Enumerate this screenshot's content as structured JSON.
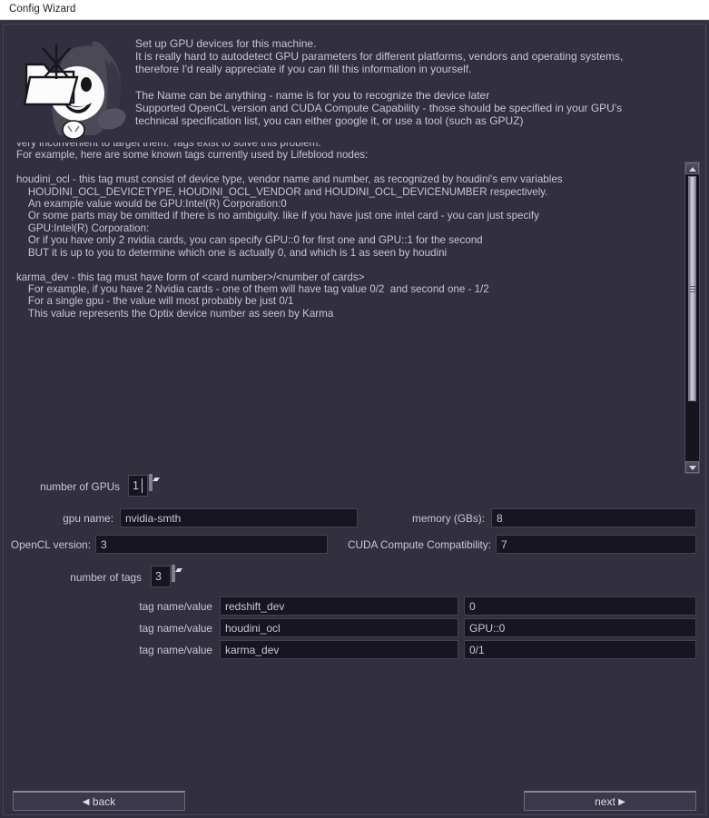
{
  "window": {
    "title": "Config Wizard"
  },
  "header": {
    "intro_text": "Set up GPU devices for this machine.\nIt is really hard to autodetect GPU parameters for different platforms, vendors and operating systems,\ntherefore I'd really appreciate if you can fill this information in yourself.\n\nThe Name can be anything - name is for you to recognize the device later\nSupported OpenCL version and CUDA Compute Capability - those should be specified in your GPU's\ntechnical specification list, you can either google it, or use a tool (such as GPUZ)",
    "mascot_alt": "lifeblood-mascot"
  },
  "description": {
    "text": "You will be able to use these resources to filter GPUs you want to calculate on\n\nNow for the tags - tags are very special.\nTags - is something different DCC nodes may use to distinguish one GPU from another.\nThe problem is - Redshift, Houdini, Karma... - they all use DIFFERENT ways of enumerating GPUs, which makes it\nvery inconvenient to target them. Tags exist to solve this problem.\nFor example, here are some known tags currently used by Lifeblood nodes:\n\nhoudini_ocl - this tag must consist of device type, vendor name and number, as recognized by houdini's env variables\n    HOUDINI_OCL_DEVICETYPE, HOUDINI_OCL_VENDOR and HOUDINI_OCL_DEVICENUMBER respectively.\n    An example value would be GPU:Intel(R) Corporation:0\n    Or some parts may be omitted if there is no ambiguity. like if you have just one intel card - you can just specify\n    GPU:Intel(R) Corporation:\n    Or if you have only 2 nvidia cards, you can specify GPU::0 for first one and GPU::1 for the second\n    BUT it is up to you to determine which one is actually 0, and which is 1 as seen by houdini\n\nkarma_dev - this tag must have form of <card number>/<number of cards>\n    For example, if you have 2 Nvidia cards - one of them will have tag value 0/2  and second one - 1/2\n    For a single gpu - the value will most probably be just 0/1\n    This value represents the Optix device number as seen by Karma"
  },
  "scrollbar": {
    "up_arrow": "scroll-up-arrow",
    "down_arrow": "scroll-down-arrow"
  },
  "form": {
    "gpu_count_label": "number of GPUs",
    "gpu_count_value": "1",
    "gpu_name_label": "gpu name:",
    "gpu_name_value": "nvidia-smth",
    "memory_label": "memory (GBs):",
    "memory_value": "8",
    "opencl_label": "OpenCL version:",
    "opencl_value": "3",
    "cuda_label": "CUDA Compute Compatibility:",
    "cuda_value": "7",
    "tag_count_label": "number of tags",
    "tag_count_value": "3",
    "tags": [
      {
        "label": "tag name/value",
        "name": "redshift_dev",
        "value": "0"
      },
      {
        "label": "tag name/value",
        "name": "houdini_ocl",
        "value": "GPU::0"
      },
      {
        "label": "tag name/value",
        "name": "karma_dev",
        "value": "0/1"
      }
    ]
  },
  "footer": {
    "back_label": "back",
    "next_label": "next",
    "back_arrow": "◀",
    "next_arrow": "▶"
  },
  "colors": {
    "window_bg": "#32303f",
    "field_bg": "#161520",
    "text": "#c9c7d3",
    "titlebar_bg": "#ffffff",
    "titlebar_text": "#1b1b1b"
  }
}
